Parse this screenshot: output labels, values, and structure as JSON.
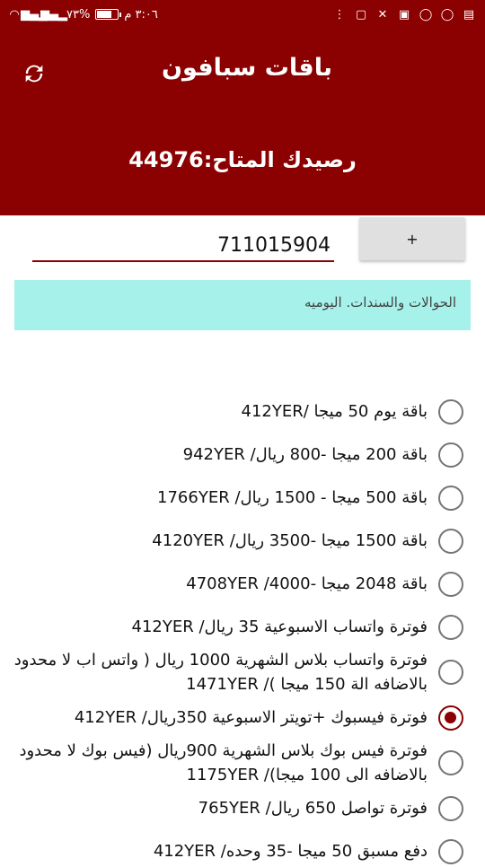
{
  "status_bar": {
    "time": "٣:٠٦ م",
    "battery_text": "%٧٣",
    "battery_level": 0.73,
    "icons": [
      "app-icon",
      "close-icon",
      "photo-icon",
      "whatsapp-icon",
      "whatsapp-icon",
      "message-icon",
      "more-icon",
      "wifi-icon",
      "signal-icon",
      "signal-icon"
    ]
  },
  "header": {
    "title": "باقات سبافون",
    "balance_label": "رصيدك المتاح:",
    "balance_value": "44976",
    "refresh_icon": "refresh-icon",
    "colors": {
      "primary": "#8b0000"
    }
  },
  "form": {
    "phone_value": "711015904",
    "add_button": "+"
  },
  "notice": "الحوالات والسندات. اليوميه",
  "packages": [
    {
      "label": "باقة يوم 50 ميجا /412YER",
      "checked": false
    },
    {
      "label": "باقة 200 ميجا -800 ريال/ 942YER",
      "checked": false
    },
    {
      "label": "باقة 500 ميجا - 1500 ريال/ 1766YER",
      "checked": false
    },
    {
      "label": "باقة 1500 ميجا -3500 ريال/ 4120YER",
      "checked": false
    },
    {
      "label": "باقة 2048 ميجا -4000/ 4708YER",
      "checked": false
    },
    {
      "label": "فوترة واتساب الاسبوعية 35 ريال/ 412YER",
      "checked": false
    },
    {
      "label": "فوترة واتساب بلاس الشهرية 1000 ريال ( واتس اب لا محدود بالاضافه الة 150 ميجا )/ 1471YER",
      "checked": false
    },
    {
      "label": "فوترة فيسبوك +تويتر الاسبوعية 350ريال/ 412YER",
      "checked": true
    },
    {
      "label": "فوترة فيس بوك بلاس الشهرية 900ريال (فيس بوك لا محدود بالاضافه الى 100 ميجا)/ 1175YER",
      "checked": false
    },
    {
      "label": "فوترة تواصل 650 ريال/ 765YER",
      "checked": false
    },
    {
      "label": "دفع مسبق 50 ميجا -35 وحده/ 412YER",
      "checked": false
    }
  ]
}
